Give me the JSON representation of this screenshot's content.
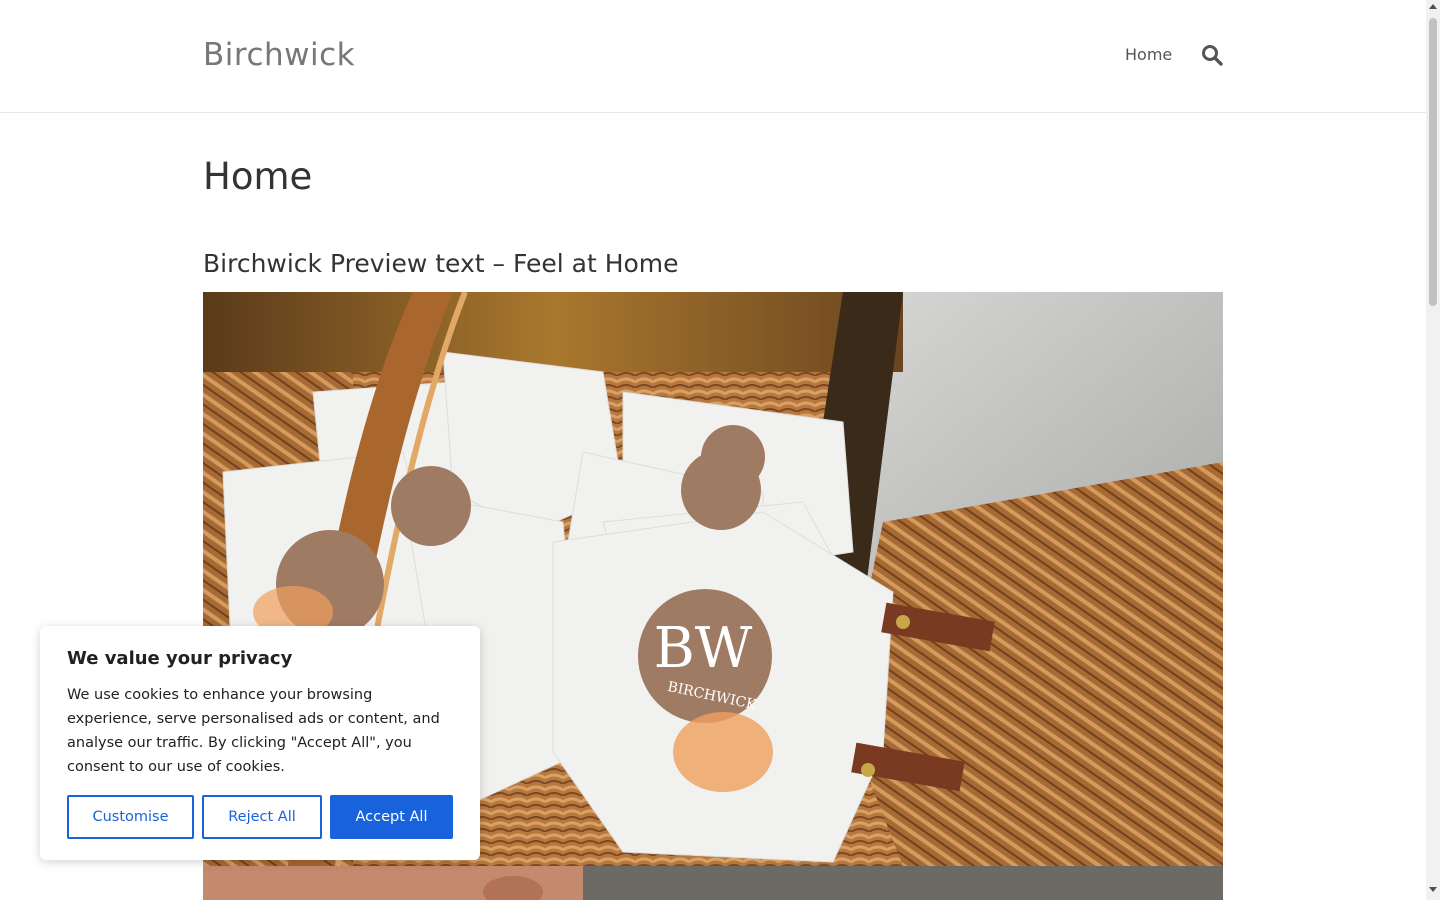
{
  "header": {
    "site_title": "Birchwick",
    "nav": [
      {
        "label": "Home"
      }
    ],
    "search_icon": "search-icon"
  },
  "main": {
    "page_title": "Home",
    "post_title": "Birchwick Preview text – Feel at Home",
    "hero_image": {
      "description_icon": "product-photo",
      "logo_text": "BW",
      "brand_text": "BIRCHWICK"
    }
  },
  "cookie_banner": {
    "title": "We value your privacy",
    "text": "We use cookies to enhance your browsing experience, serve personalised ads or content, and analyse our traffic. By clicking \"Accept All\", you consent to our use of cookies.",
    "buttons": {
      "customise": "Customise",
      "reject": "Reject All",
      "accept": "Accept All"
    },
    "accent_color": "#1863dc"
  }
}
